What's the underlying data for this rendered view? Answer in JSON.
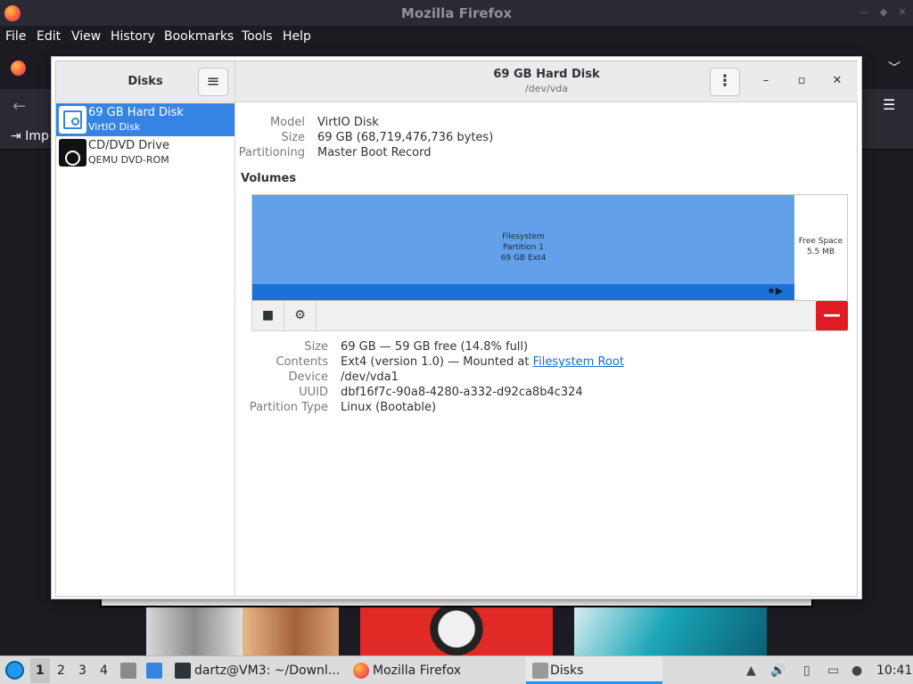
{
  "firefox": {
    "title": "Mozilla Firefox",
    "menus": [
      "File",
      "Edit",
      "View",
      "History",
      "Bookmarks",
      "Tools",
      "Help"
    ],
    "bookmark_fragment": "Imp"
  },
  "disks": {
    "sidebar_title": "Disks",
    "devices": [
      {
        "name": "69 GB Hard Disk",
        "sub": "VirtIO Disk"
      },
      {
        "name": "CD/DVD Drive",
        "sub": "QEMU DVD-ROM"
      }
    ],
    "header": {
      "title": "69 GB Hard Disk",
      "subtitle": "/dev/vda"
    },
    "drive_props": {
      "model_label": "Model",
      "model": "VirtIO Disk",
      "size_label": "Size",
      "size": "69 GB (68,719,476,736 bytes)",
      "partitioning_label": "Partitioning",
      "partitioning": "Master Boot Record"
    },
    "volumes_title": "Volumes",
    "partition": {
      "line1": "Filesystem",
      "line2": "Partition 1",
      "line3": "69 GB Ext4",
      "fraction": 0.909
    },
    "free_space": {
      "line1": "Free Space",
      "line2": "5.5 MB"
    },
    "volume_props": {
      "size_label": "Size",
      "size": "69 GB — 59 GB free (14.8% full)",
      "contents_label": "Contents",
      "contents_text": "Ext4 (version 1.0) — Mounted at",
      "contents_link": "Filesystem Root",
      "device_label": "Device",
      "device": "/dev/vda1",
      "uuid_label": "UUID",
      "uuid": "dbf16f7c-90a8-4280-a332-d92ca8b4c324",
      "ptype_label": "Partition Type",
      "ptype": "Linux (Bootable)"
    }
  },
  "taskbar": {
    "workspaces": [
      "1",
      "2",
      "3",
      "4"
    ],
    "tasks": [
      "dartz@VM3: ~/Downl...",
      "Mozilla Firefox",
      "Disks"
    ],
    "clock": "10:41"
  },
  "colors": {
    "accent": "#3584e4",
    "partition": "#62a0ea",
    "danger": "#e01b24"
  }
}
